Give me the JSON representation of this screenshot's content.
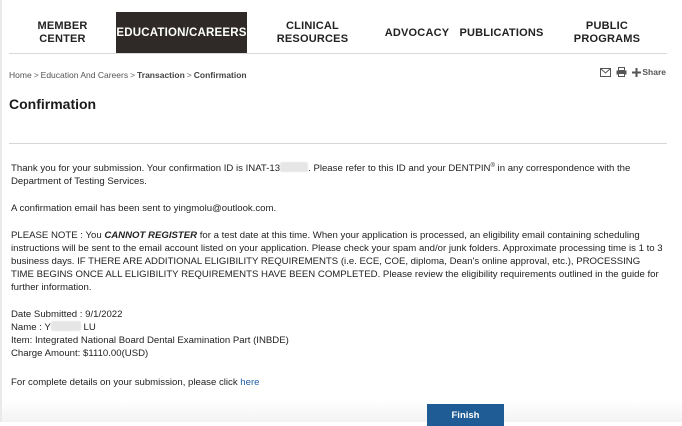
{
  "nav": {
    "items": [
      {
        "label": "MEMBER\nCENTER"
      },
      {
        "label": "EDUCATION/CAREERS"
      },
      {
        "label": "CLINICAL\nRESOURCES"
      },
      {
        "label": "ADVOCACY"
      },
      {
        "label": "PUBLICATIONS"
      },
      {
        "label": "PUBLIC\nPROGRAMS"
      }
    ],
    "active_index": 1
  },
  "breadcrumb": {
    "items": [
      "Home",
      "Education And Careers",
      "Transaction",
      "Confirmation"
    ],
    "separator": ">"
  },
  "tools": {
    "icons": [
      "email-icon",
      "print-icon",
      "plus-icon"
    ],
    "share_label": "Share"
  },
  "page": {
    "title": "Confirmation"
  },
  "content": {
    "thanks_before": "Thank you for your submission. Your confirmation ID is INAT-13",
    "thanks_after": ". Please refer to this ID and your DENTPIN",
    "thanks_reg": "®",
    "thanks_end": " in any correspondence with the Department of Testing Services.",
    "email_sent": "A confirmation email has been sent to yingmolu@outlook.com.",
    "note_prefix": "PLEASE NOTE : You ",
    "note_emphasis": "CANNOT REGISTER",
    "note_rest": " for a test date at this time. When your application is processed, an eligibility email containing scheduling instructions will be sent to the email account listed on your application. Please check your spam and/or junk folders. Approximate processing time is 1 to 3 business days. IF THERE ARE ADDITIONAL ELIGIBILITY REQUIREMENTS (i.e. ECE, COE, diploma, Dean's online approval, etc.), PROCESSING TIME BEGINS ONCE ALL ELIGIBILITY REQUIREMENTS HAVE BEEN COMPLETED. Please review the eligibility requirements outlined in the guide for further information.",
    "date_submitted": "Date Submitted : 9/1/2022",
    "name_prefix": "Name : Y",
    "name_suffix": " LU",
    "item": "Item: Integrated National Board Dental Examination Part (INBDE)",
    "charge": "Charge Amount: $1110.00(USD)",
    "details_text": "For complete details on your submission, please click ",
    "details_link": "here"
  },
  "actions": {
    "finish_label": "Finish"
  },
  "colors": {
    "active_nav_bg": "#2f2a27",
    "finish_bg": "#1f5b94",
    "link": "#1f5fa8"
  }
}
